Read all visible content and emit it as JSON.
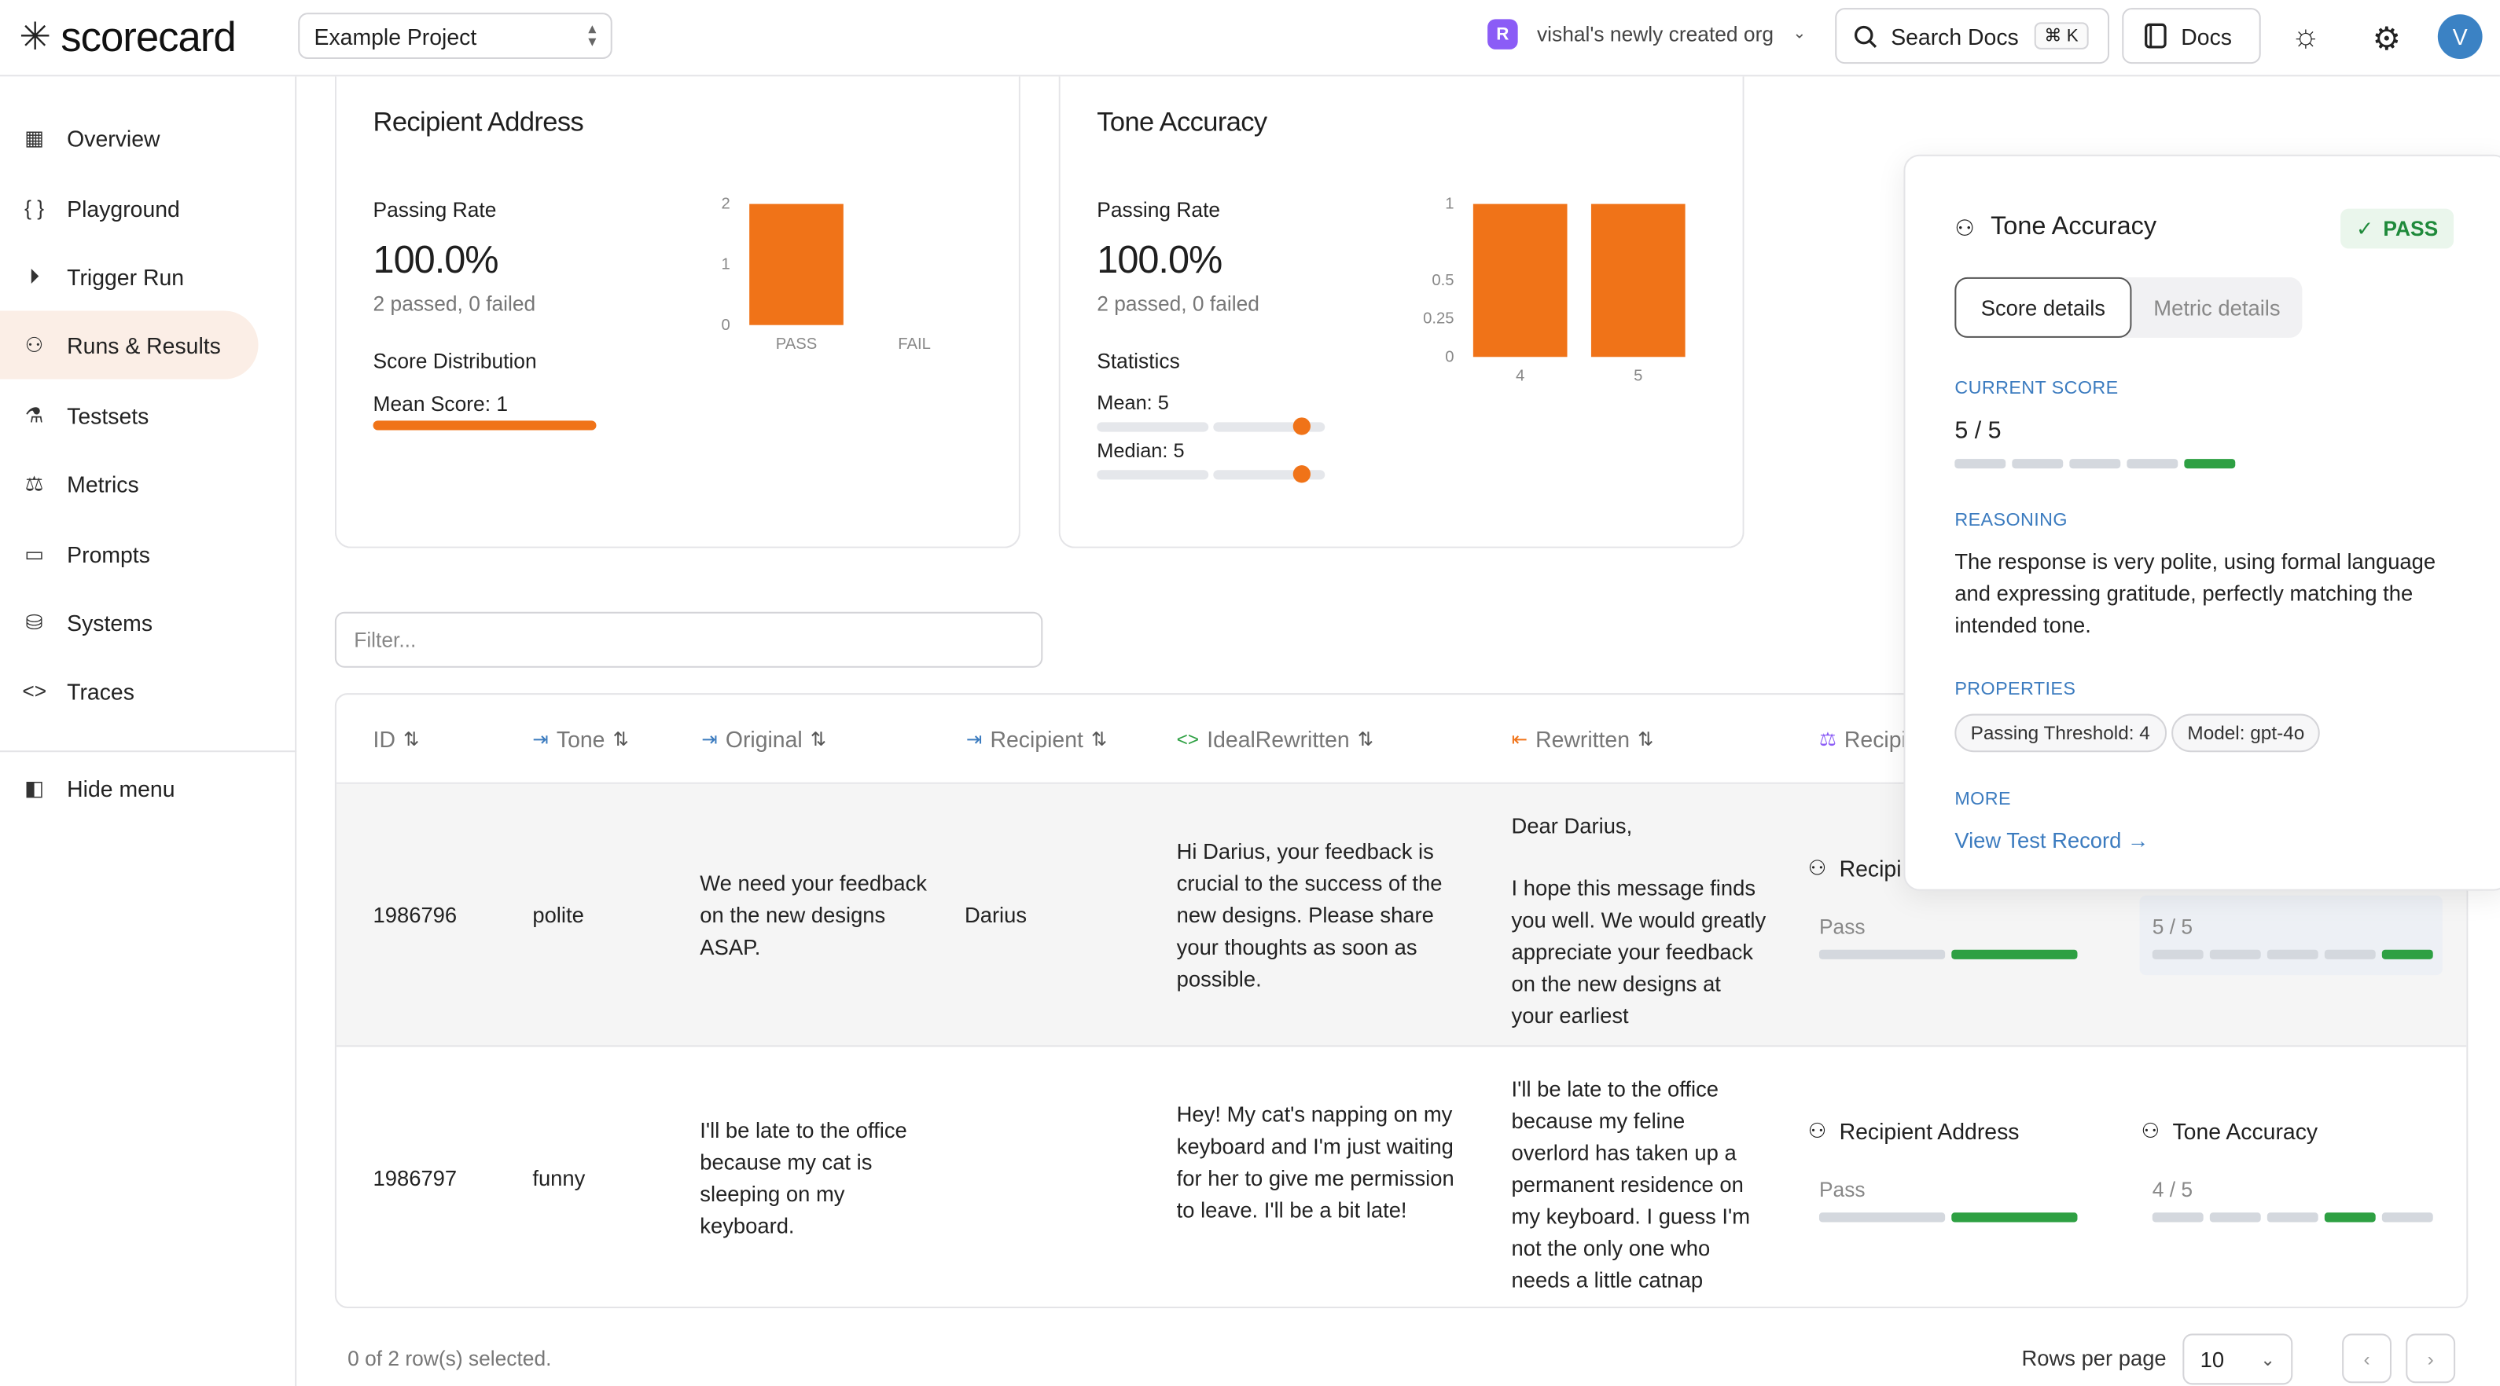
{
  "app": {
    "logo_text": "scorecard",
    "logo_mark": "✳"
  },
  "header": {
    "project": "Example Project",
    "org_initial": "R",
    "org_name": "vishal's newly created org",
    "search_label": "Search Docs",
    "search_kbd": "⌘ K",
    "docs_label": "Docs",
    "avatar_initial": "V"
  },
  "sidebar": {
    "items": [
      {
        "label": "Overview",
        "icon": "grid-icon"
      },
      {
        "label": "Playground",
        "icon": "braces-icon"
      },
      {
        "label": "Trigger Run",
        "icon": "play-circle-icon"
      },
      {
        "label": "Runs & Results",
        "icon": "runs-icon",
        "active": true
      },
      {
        "label": "Testsets",
        "icon": "flask-icon"
      },
      {
        "label": "Metrics",
        "icon": "scale-icon"
      },
      {
        "label": "Prompts",
        "icon": "message-icon"
      },
      {
        "label": "Systems",
        "icon": "system-icon"
      },
      {
        "label": "Traces",
        "icon": "code-icon"
      }
    ],
    "hide_menu": "Hide menu"
  },
  "cards": {
    "recipient": {
      "title": "Recipient Address",
      "passing_rate_label": "Passing Rate",
      "passing_rate": "100.0%",
      "passed_text": "2 passed, 0 failed",
      "dist_label": "Score Distribution",
      "mean_label": "Mean Score: 1",
      "mean_fraction": 1.0
    },
    "tone": {
      "title": "Tone Accuracy",
      "passing_rate_label": "Passing Rate",
      "passing_rate": "100.0%",
      "passed_text": "2 passed, 0 failed",
      "stats_label": "Statistics",
      "mean_label": "Mean: 5",
      "median_label": "Median: 5"
    }
  },
  "chart_data": [
    {
      "type": "bar",
      "categories": [
        "PASS",
        "FAIL"
      ],
      "values": [
        2,
        0
      ],
      "yticks": [
        "2",
        "1",
        "0"
      ],
      "ylim": [
        0,
        2
      ]
    },
    {
      "type": "bar",
      "categories": [
        "4",
        "5"
      ],
      "values": [
        1,
        1
      ],
      "yticks": [
        "1",
        "0.5",
        "0.25",
        "0"
      ],
      "ylim": [
        0,
        1
      ]
    }
  ],
  "filter": {
    "placeholder": "Filter..."
  },
  "table": {
    "columns": [
      {
        "label": "ID",
        "icon": ""
      },
      {
        "label": "Tone",
        "icon": "input-icon"
      },
      {
        "label": "Original",
        "icon": "input-icon"
      },
      {
        "label": "Recipient",
        "icon": "input-icon"
      },
      {
        "label": "IdealRewritten",
        "icon": "code-icon"
      },
      {
        "label": "Rewritten",
        "icon": "output-icon"
      },
      {
        "label": "Recipi",
        "icon": "scale-icon"
      }
    ],
    "rows": [
      {
        "id": "1986796",
        "tone": "polite",
        "original": "We need your feedback on the new designs ASAP.",
        "recipient": "Darius",
        "ideal": "Hi Darius, your feedback is crucial to the success of the new designs. Please share your thoughts as soon as possible.",
        "rewritten_a": "Dear Darius,",
        "rewritten_b": "I hope this message finds you well. We would greatly appreciate your feedback on the new designs at your earliest",
        "metric1_title": "Recipi",
        "metric1_value": "Pass",
        "metric2_value": "5 / 5",
        "metric2_score": 5
      },
      {
        "id": "1986797",
        "tone": "funny",
        "original": "I'll be late to the office because my cat is sleeping on my keyboard.",
        "recipient": "",
        "ideal": "Hey! My cat's napping on my keyboard and I'm just waiting for her to give me permission to leave. I'll be a bit late!",
        "rewritten_a": "I'll be late to the office because my feline overlord has taken up a permanent residence on my keyboard. I guess I'm not the only one who needs a little catnap",
        "rewritten_b": "",
        "metric1_title": "Recipient Address",
        "metric1_value": "Pass",
        "metric2_title": "Tone Accuracy",
        "metric2_value": "4 / 5",
        "metric2_score": 4
      }
    ]
  },
  "footer": {
    "selected": "0 of 2 row(s) selected.",
    "rows_per_page_label": "Rows per page",
    "rows_per_page": "10"
  },
  "popover": {
    "title": "Tone Accuracy",
    "status": "PASS",
    "tab_active": "Score details",
    "tab_inactive": "Metric details",
    "current_score_label": "CURRENT SCORE",
    "current_score": "5 / 5",
    "score": 5,
    "reasoning_label": "REASONING",
    "reasoning": "The response is very polite, using formal language and expressing gratitude, perfectly matching the intended tone.",
    "properties_label": "PROPERTIES",
    "prop_threshold_key": "Passing Threshold:",
    "prop_threshold_val": "4",
    "prop_model_key": "Model:",
    "prop_model_val": "gpt-4o",
    "more_label": "MORE",
    "link": "View Test Record →"
  },
  "colors": {
    "accent": "#f07318",
    "pass": "#2ea043",
    "link": "#3b7bbf"
  }
}
